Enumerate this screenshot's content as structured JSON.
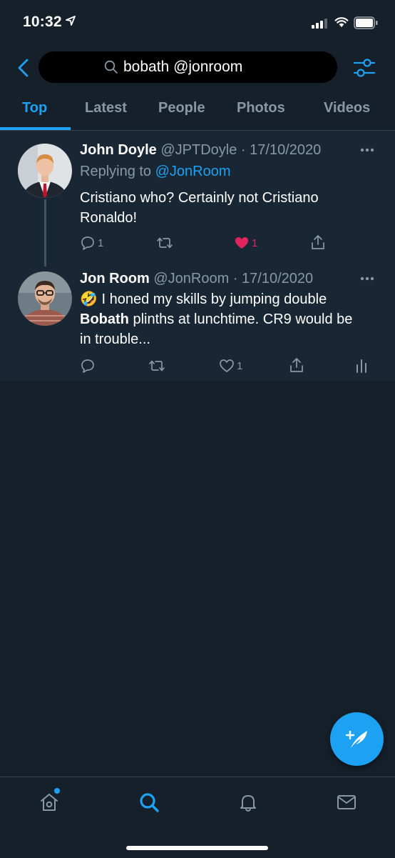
{
  "status_bar": {
    "time": "10:32"
  },
  "search": {
    "query": "bobath @jonroom"
  },
  "tabs": [
    {
      "label": "Top",
      "active": true
    },
    {
      "label": "Latest"
    },
    {
      "label": "People"
    },
    {
      "label": "Photos"
    },
    {
      "label": "Videos"
    }
  ],
  "tweets": [
    {
      "name": "John Doyle",
      "handle": "@JPTDoyle",
      "separator": "·",
      "date": "17/10/2020",
      "replying_label": "Replying to",
      "replying_to": "@JonRoom",
      "text_lines": [
        "Cristiano who? Certainly not Cristiano",
        "Ronaldo!"
      ],
      "reply_count": "1",
      "retweet_count": "",
      "like_count": "1",
      "liked": true
    },
    {
      "name": "Jon Room",
      "handle": "@JonRoom",
      "separator": "·",
      "date": "17/10/2020",
      "emoji": "🤣",
      "text_part1": " I honed my skills by jumping double",
      "text_bold": "Bobath",
      "text_part2": " plinths at lunchtime. CR9 would be",
      "text_part3": "in trouble...",
      "reply_count": "",
      "retweet_count": "",
      "like_count": "1",
      "liked": false
    }
  ],
  "colors": {
    "background": "#15202b",
    "feed_background": "#192734",
    "accent": "#1da1f2",
    "like": "#e0245e",
    "secondary_text": "#8899a6"
  },
  "icons": {
    "status": [
      "location-arrow-icon",
      "signal-icon",
      "wifi-icon",
      "battery-icon"
    ],
    "header": [
      "back-chevron-icon",
      "search-icon",
      "filter-sliders-icon"
    ],
    "tweet_actions": [
      "reply-icon",
      "retweet-icon",
      "like-icon",
      "share-icon",
      "analytics-icon"
    ],
    "bottom_nav": [
      "home-icon",
      "search-icon",
      "notifications-bell-icon",
      "messages-envelope-icon"
    ],
    "fab": "compose-tweet-icon"
  }
}
